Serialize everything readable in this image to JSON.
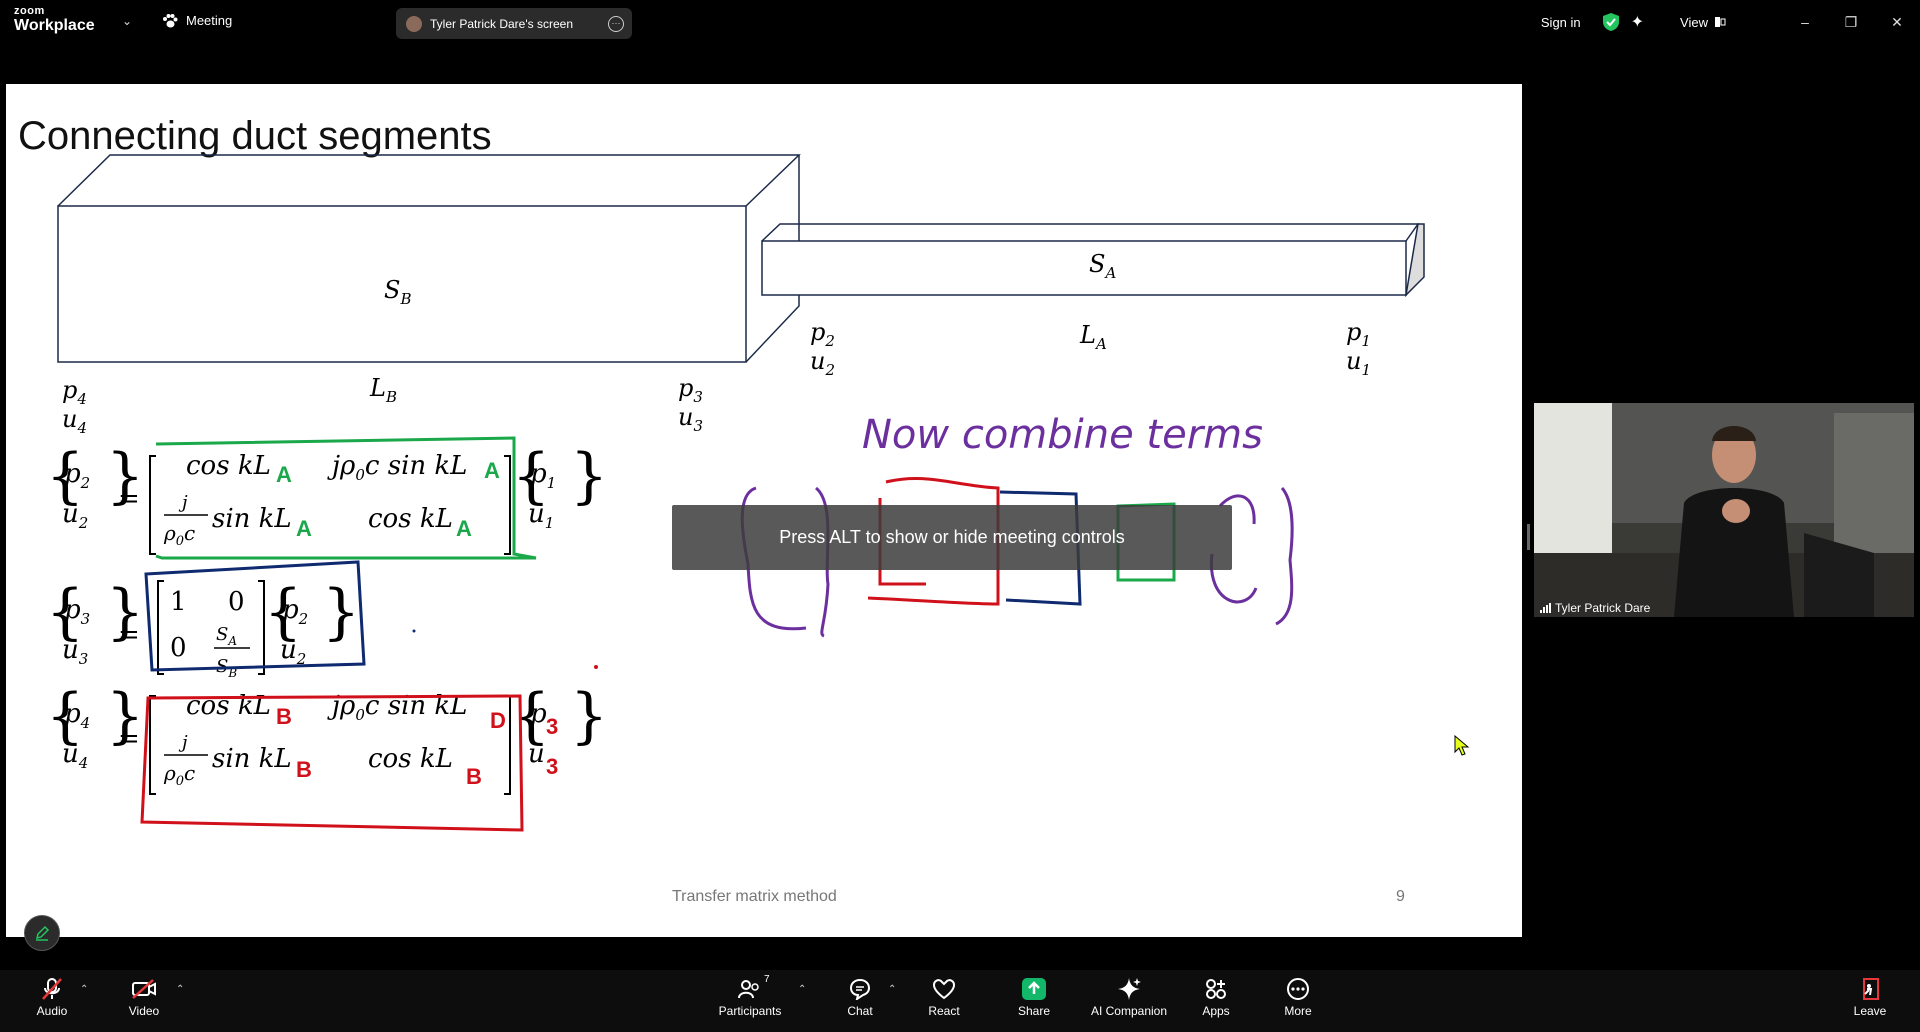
{
  "titlebar": {
    "logo_line1": "zoom",
    "logo_line2": "Workplace",
    "meeting_label": "Meeting",
    "screen_label": "Tyler Patrick Dare's screen",
    "sign_in": "Sign in",
    "view": "View"
  },
  "slide": {
    "title": "Connecting duct segments",
    "footer": "Transfer matrix method",
    "page_number": "9"
  },
  "toast": "Press ALT to show or hide meeting controls",
  "handwriting": "Now combine terms",
  "video": {
    "participant_name": "Tyler Patrick Dare"
  },
  "controls": {
    "audio": "Audio",
    "video": "Video",
    "participants": "Participants",
    "participants_count": "7",
    "chat": "Chat",
    "react": "React",
    "share": "Share",
    "ai_companion": "AI Companion",
    "apps": "Apps",
    "more": "More",
    "leave": "Leave"
  },
  "colors": {
    "share_green": "#12b76a",
    "ink_green": "#1aa84a",
    "ink_navy": "#0f2a6e",
    "ink_red": "#d0101a",
    "ink_purple": "#6b2f9e",
    "shield_green": "#22c55e"
  }
}
